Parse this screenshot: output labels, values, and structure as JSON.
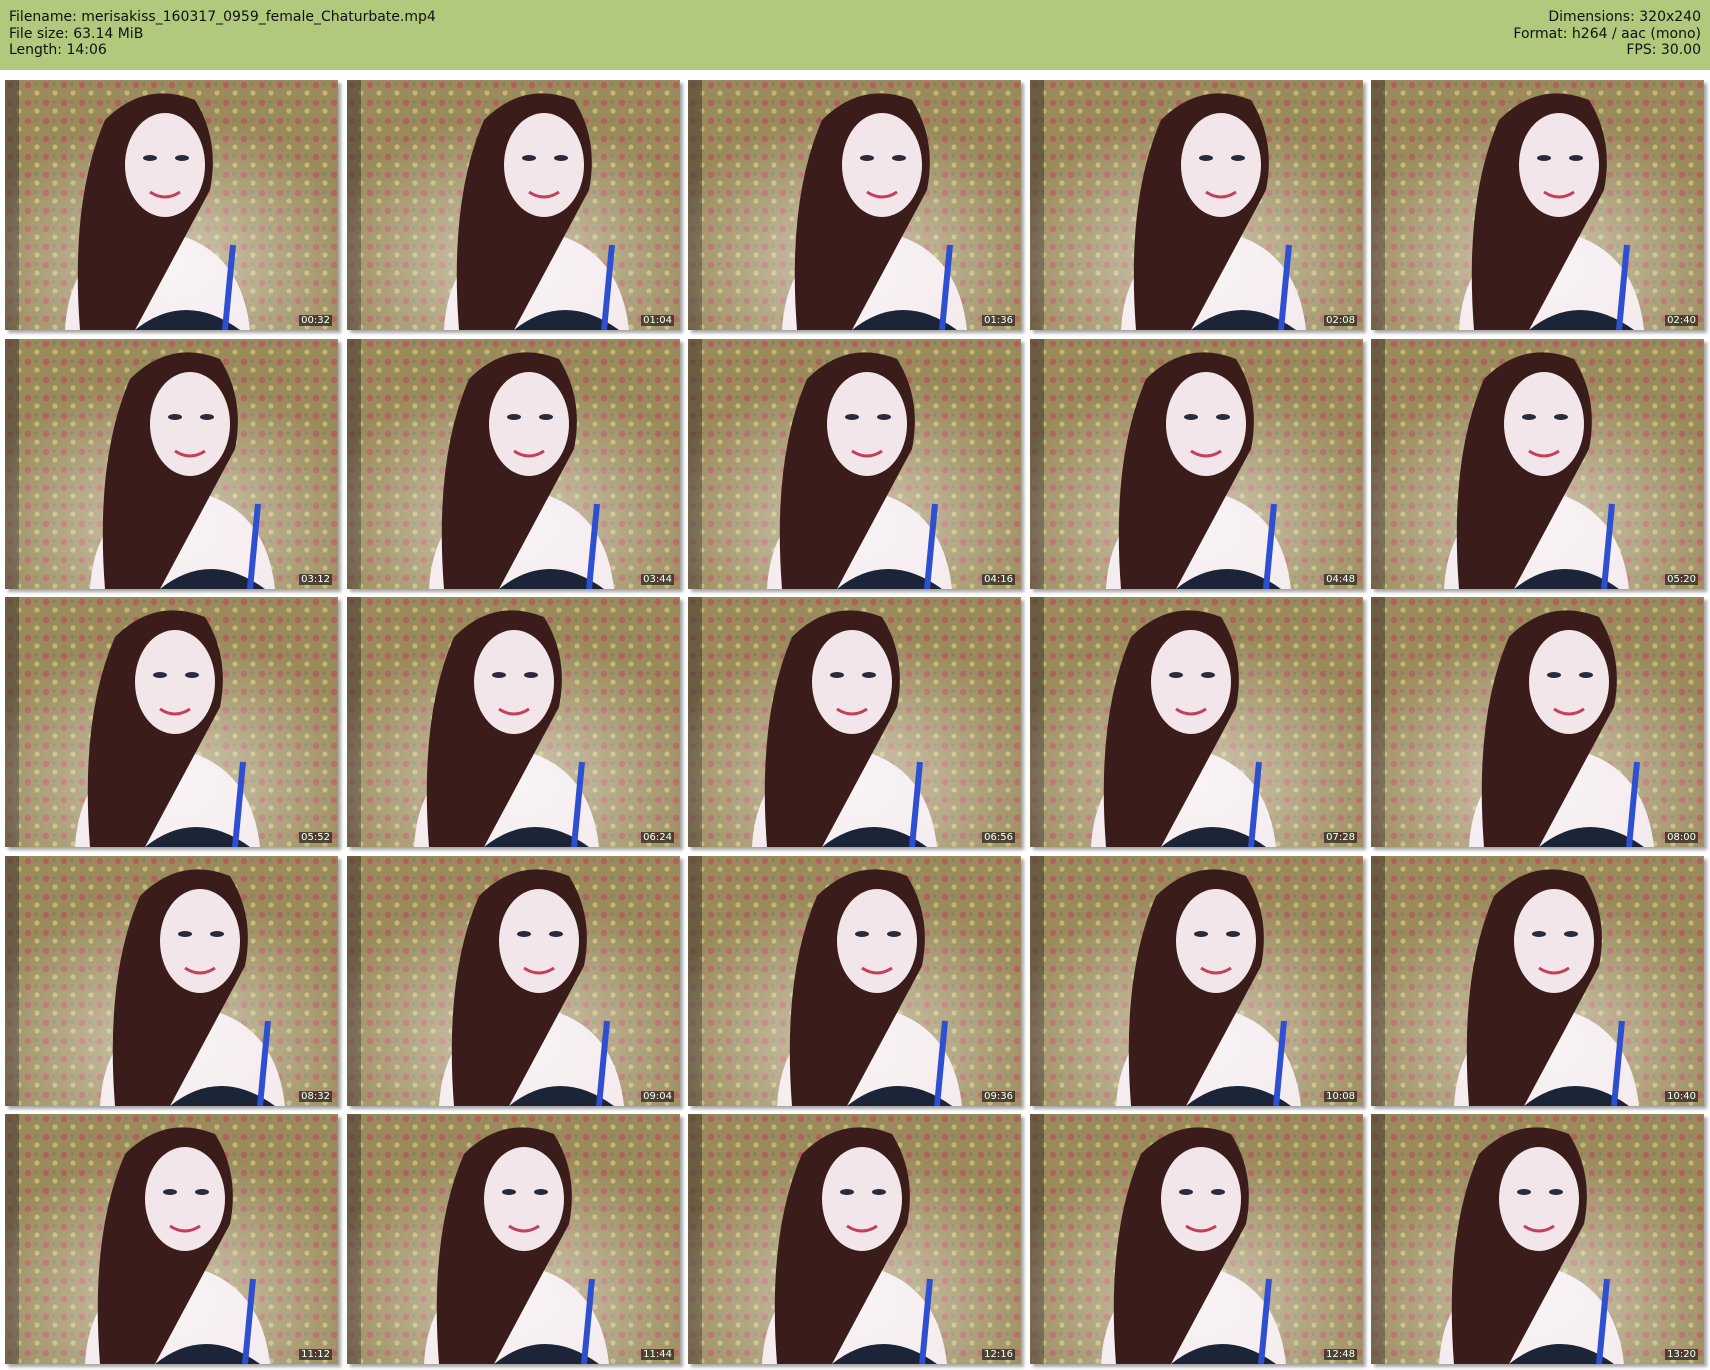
{
  "header": {
    "filename": "Filename: merisakiss_160317_0959_female_Chaturbate.mp4",
    "filesize": "File size: 63.14 MiB",
    "length": "Length: 14:06",
    "dimensions": "Dimensions: 320x240",
    "format": "Format: h264 / aac (mono)",
    "fps": "FPS: 30.00"
  },
  "colors": {
    "header_bg": "#b0c97d",
    "wallpaper": "#9b8a5c",
    "hair": "#3a1d1a",
    "skin": "#f2e6ea",
    "top": "#1c2438",
    "strap": "#2d4fd0"
  },
  "thumbnails": [
    {
      "time": "00:32"
    },
    {
      "time": "01:04"
    },
    {
      "time": "01:36"
    },
    {
      "time": "02:08"
    },
    {
      "time": "02:40"
    },
    {
      "time": "03:12"
    },
    {
      "time": "03:44"
    },
    {
      "time": "04:16"
    },
    {
      "time": "04:48"
    },
    {
      "time": "05:20"
    },
    {
      "time": "05:52"
    },
    {
      "time": "06:24"
    },
    {
      "time": "06:56"
    },
    {
      "time": "07:28"
    },
    {
      "time": "08:00"
    },
    {
      "time": "08:32"
    },
    {
      "time": "09:04"
    },
    {
      "time": "09:36"
    },
    {
      "time": "10:08"
    },
    {
      "time": "10:40"
    },
    {
      "time": "11:12"
    },
    {
      "time": "11:44"
    },
    {
      "time": "12:16"
    },
    {
      "time": "12:48"
    },
    {
      "time": "13:20"
    }
  ]
}
